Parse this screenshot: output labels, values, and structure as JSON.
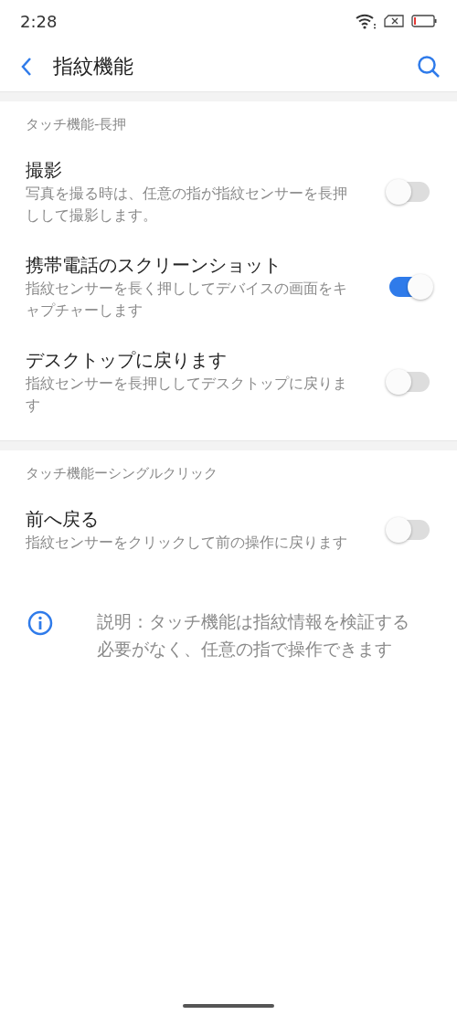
{
  "status_bar": {
    "time": "2:28"
  },
  "header": {
    "title": "指紋機能"
  },
  "sections": [
    {
      "title": "タッチ機能-長押",
      "items": [
        {
          "title": "撮影",
          "description": "写真を撮る時は、任意の指が指紋センサーを長押しして撮影します。",
          "on": false
        },
        {
          "title": "携帯電話のスクリーンショット",
          "description": "指紋センサーを長く押ししてデバイスの画面をキャプチャーします",
          "on": true
        },
        {
          "title": "デスクトップに戻ります",
          "description": "指紋センサーを長押ししてデスクトップに戻ります",
          "on": false
        }
      ]
    },
    {
      "title": "タッチ機能ーシングルクリック",
      "items": [
        {
          "title": "前へ戻る",
          "description": "指紋センサーをクリックして前の操作に戻ります",
          "on": false
        }
      ]
    }
  ],
  "note": "説明：タッチ機能は指紋情報を検証する必要がなく、任意の指で操作できます"
}
